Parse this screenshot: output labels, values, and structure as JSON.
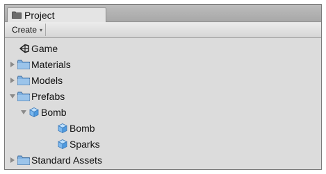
{
  "tab": {
    "title": "Project",
    "icon": "folder-icon"
  },
  "toolbar": {
    "create_label": "Create",
    "create_caret": "▾"
  },
  "tree": {
    "game": "Game",
    "materials": "Materials",
    "models": "Models",
    "prefabs": "Prefabs",
    "bomb_group": "Bomb",
    "bomb": "Bomb",
    "sparks": "Sparks",
    "standard_assets": "Standard Assets"
  },
  "colors": {
    "folder": "#6fa1d6",
    "prefab_cube": "#5aa9e6",
    "panel": "#dcdcdc"
  }
}
